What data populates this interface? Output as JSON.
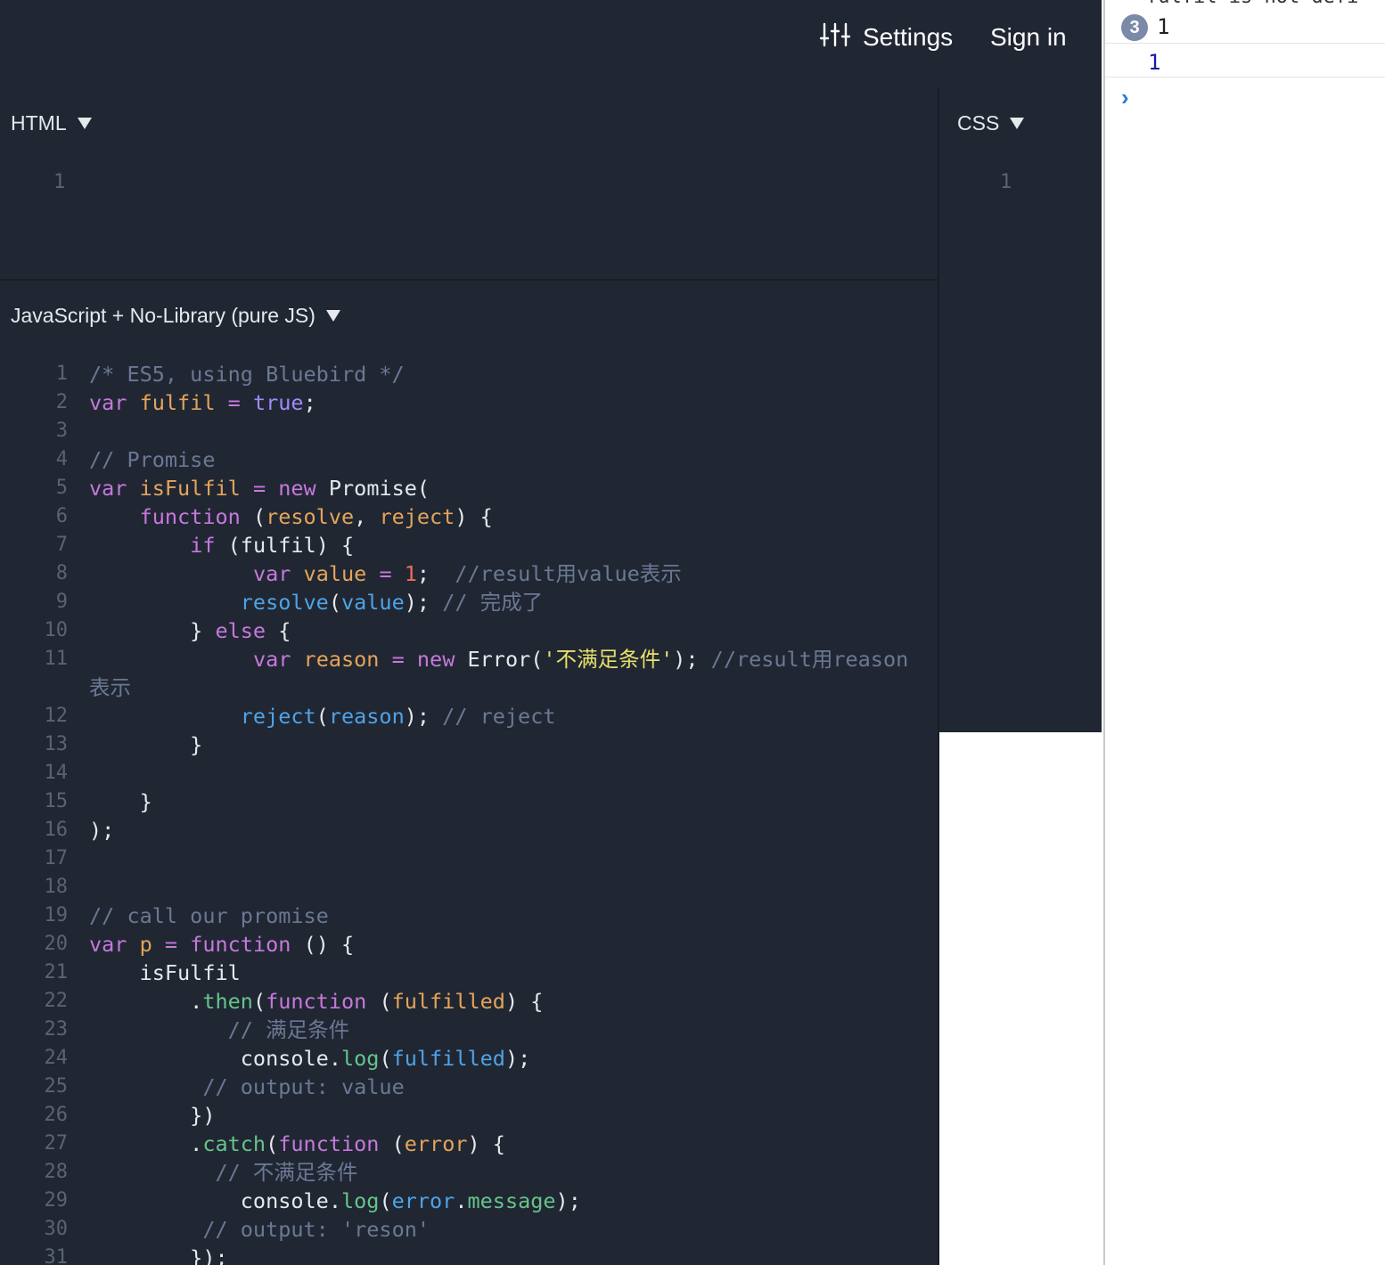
{
  "header": {
    "settings_label": "Settings",
    "signin_label": "Sign in",
    "settings_icon": "sliders-icon"
  },
  "html_pane": {
    "label": "HTML",
    "line_number": "1"
  },
  "css_pane": {
    "label": "CSS",
    "line_number": "1"
  },
  "js_pane": {
    "label": "JavaScript + No-Library (pure JS)",
    "lines": [
      {
        "n": "1",
        "t": "/* ES5, using Bluebird */"
      },
      {
        "n": "2",
        "t": "var fulfil = true;"
      },
      {
        "n": "3",
        "t": ""
      },
      {
        "n": "4",
        "t": "// Promise"
      },
      {
        "n": "5",
        "t": "var isFulfil = new Promise("
      },
      {
        "n": "6",
        "t": "    function (resolve, reject) {"
      },
      {
        "n": "7",
        "t": "        if (fulfil) {"
      },
      {
        "n": "8",
        "t": "             var value = 1;  //result用value表示"
      },
      {
        "n": "9",
        "t": "            resolve(value); // 完成了"
      },
      {
        "n": "10",
        "t": "        } else {"
      },
      {
        "n": "11",
        "t": "             var reason = new Error('不满足条件'); //result用reason"
      },
      {
        "n": "",
        "t": "表示"
      },
      {
        "n": "12",
        "t": "            reject(reason); // reject"
      },
      {
        "n": "13",
        "t": "        }"
      },
      {
        "n": "14",
        "t": ""
      },
      {
        "n": "15",
        "t": "    }"
      },
      {
        "n": "16",
        "t": ");"
      },
      {
        "n": "17",
        "t": ""
      },
      {
        "n": "18",
        "t": ""
      },
      {
        "n": "19",
        "t": "// call our promise"
      },
      {
        "n": "20",
        "t": "var p = function () {"
      },
      {
        "n": "21",
        "t": "    isFulfil"
      },
      {
        "n": "22",
        "t": "        .then(function (fulfilled) {"
      },
      {
        "n": "23",
        "t": "           // 满足条件"
      },
      {
        "n": "24",
        "t": "            console.log(fulfilled);"
      },
      {
        "n": "25",
        "t": "         // output: value"
      },
      {
        "n": "26",
        "t": "        })"
      },
      {
        "n": "27",
        "t": "        .catch(function (error) {"
      },
      {
        "n": "28",
        "t": "          // 不满足条件"
      },
      {
        "n": "29",
        "t": "            console.log(error.message);"
      },
      {
        "n": "30",
        "t": "         // output: 'reson'"
      },
      {
        "n": "31",
        "t": "        });"
      }
    ]
  },
  "console": {
    "clipped_text": "fulfil is not defi",
    "entries": [
      {
        "badge": "3",
        "value": "1"
      },
      {
        "badge": "",
        "value": "1"
      }
    ],
    "prompt_icon": "chevron-right-icon",
    "prompt": "›"
  }
}
